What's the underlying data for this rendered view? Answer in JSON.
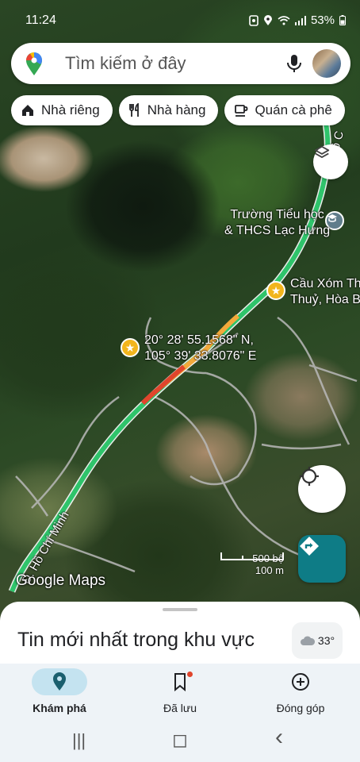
{
  "status_bar": {
    "time": "11:24",
    "battery": "53%"
  },
  "search": {
    "placeholder": "Tìm kiếm ở đây"
  },
  "chips": [
    {
      "label": "Nhà riêng",
      "icon": "home-icon"
    },
    {
      "label": "Nhà hàng",
      "icon": "restaurant-icon"
    },
    {
      "label": "Quán cà phê",
      "icon": "coffee-icon"
    }
  ],
  "map": {
    "dropped_pin": {
      "lat": "20° 28' 55.1568\" N,",
      "lng": "105° 39' 33.8076\" E"
    },
    "places": [
      {
        "line1": "Trường Tiểu học",
        "line2": "& THCS Lạc Hưng"
      },
      {
        "line1": "Cầu Xóm Th",
        "line2": "Thuỷ, Hòa B"
      }
    ],
    "road_names": [
      "Đ. Hồ Chí Minh",
      "Hồ C"
    ],
    "scale": {
      "top": "500 bộ",
      "bottom": "100 m"
    },
    "watermark": "Google Maps",
    "traffic_colors": {
      "free": "#2fc46b",
      "slow": "#f3a93b",
      "heavy": "#e0452c"
    }
  },
  "sheet": {
    "title": "Tin mới nhất trong khu vực",
    "weather": "33°"
  },
  "bottom_nav": [
    {
      "label": "Khám phá",
      "icon": "explore-pin-icon",
      "active": true
    },
    {
      "label": "Đã lưu",
      "icon": "bookmark-icon",
      "active": false
    },
    {
      "label": "Đóng góp",
      "icon": "add-circle-icon",
      "active": false
    }
  ],
  "system_nav": {
    "recents": "|||",
    "home": "◻",
    "back": "‹"
  }
}
